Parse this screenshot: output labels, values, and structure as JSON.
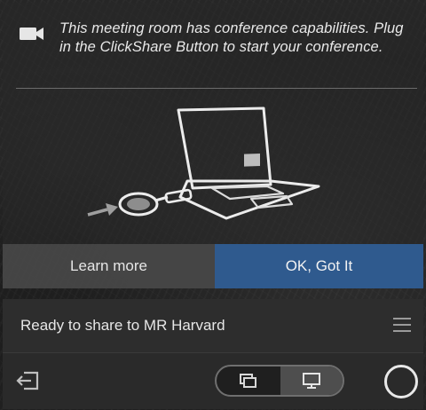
{
  "notification": {
    "message": "This meeting room has conference capabilities. Plug in the ClickShare Button to start your conference.",
    "icon": "video-camera-icon",
    "learn_more_label": "Learn more",
    "ok_label": "OK, Got It"
  },
  "status": {
    "text": "Ready to share to MR Harvard",
    "menu_icon": "hamburger-menu-icon"
  },
  "toolbar": {
    "exit_icon": "exit-icon",
    "toggle": {
      "options": [
        "window-share-icon",
        "desktop-share-icon"
      ],
      "selected": "desktop-share-icon"
    },
    "record_icon": "circle-button-icon"
  },
  "colors": {
    "accent": "#2f5a8e",
    "secondary_button": "#484848",
    "status_bar": "#2d2d2d",
    "text": "#e6e6e6"
  }
}
